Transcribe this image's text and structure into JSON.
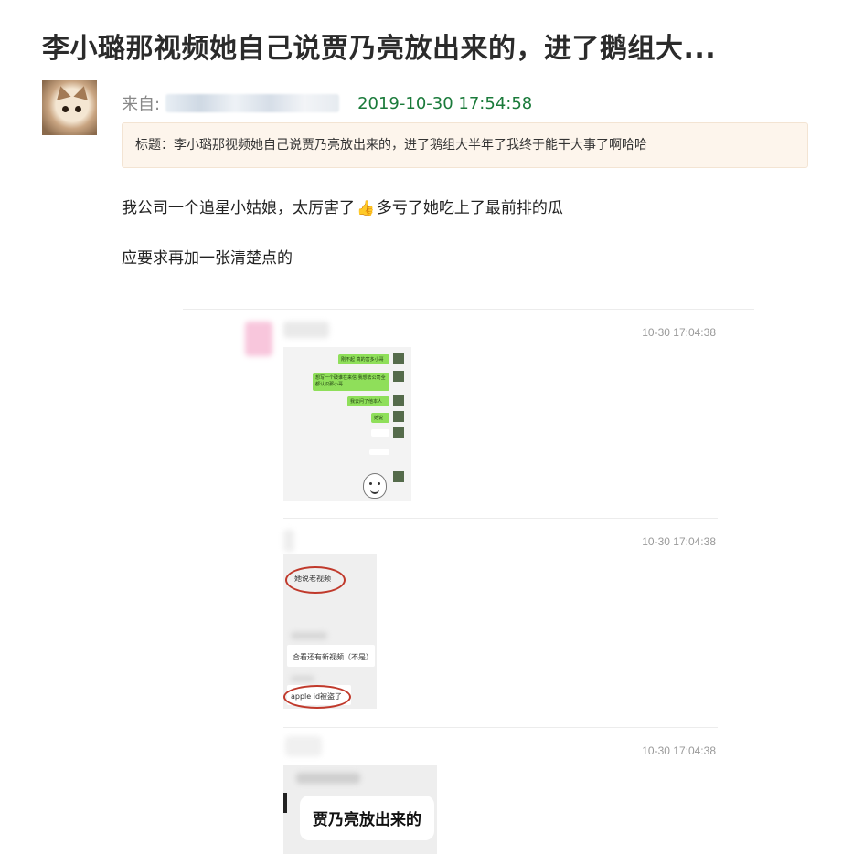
{
  "post": {
    "title": "李小璐那视频她自己说贾乃亮放出来的，进了鹅组大...",
    "from_label": "来自:",
    "timestamp": "2019-10-30 17:54:58",
    "subject": "标题：李小璐那视频她自己说贾乃亮放出来的，进了鹅组大半年了我终于能干大事了啊哈哈",
    "body_line1_part1": "我公司一个追星小姑娘，太厉害了",
    "body_line1_part2": "多亏了她吃上了最前排的瓜",
    "body_line2": "应要求再加一张清楚点的",
    "thumb_icon": "thumbs-up-icon"
  },
  "screenshots": [
    {
      "time": "10-30 17:04:38",
      "messages": [
        "刚不起 真的害多小哥",
        "想写一个破谁在来信 我想去公司全都认识那小哥",
        "我去问了他本人",
        "她说",
        "…",
        "…"
      ]
    },
    {
      "time": "10-30 17:04:38",
      "notes": [
        "她说老视频",
        "合看还有新视频（不是）",
        "apple id被盗了"
      ]
    },
    {
      "time": "10-30 17:04:38",
      "caption": "贾乃亮放出来的"
    }
  ]
}
